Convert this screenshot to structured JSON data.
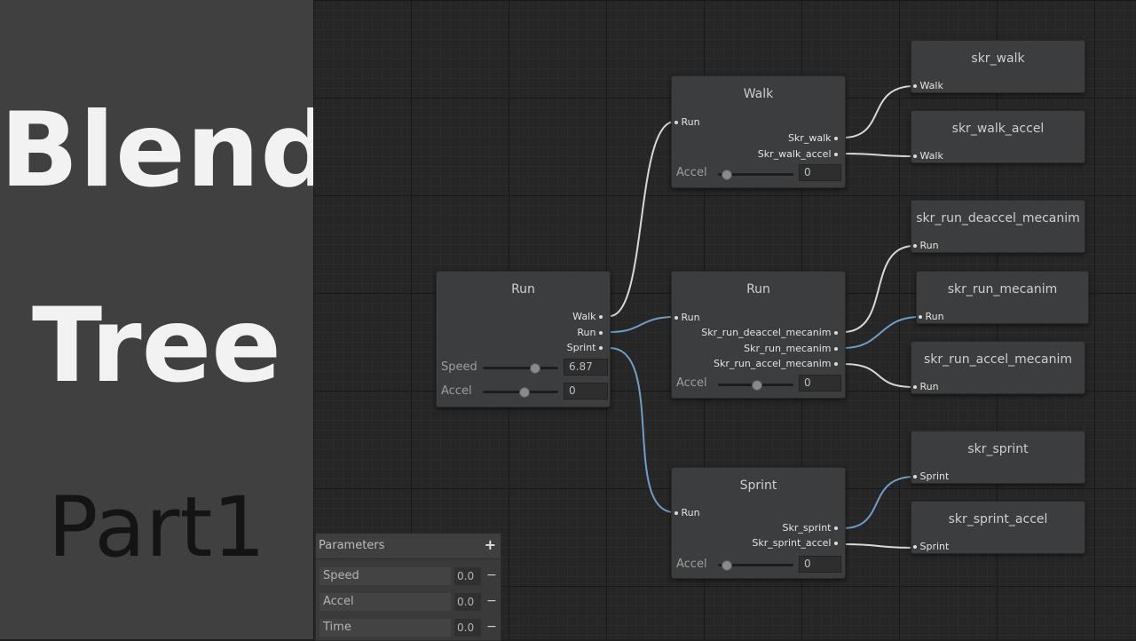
{
  "title_lines": [
    "Blend",
    "Tree",
    "Part1"
  ],
  "nodes": {
    "root": {
      "title": "Run",
      "outputs": [
        "Walk",
        "Run",
        "Sprint"
      ],
      "speed_label": "Speed",
      "speed_value": "6.87",
      "accel_label": "Accel",
      "accel_value": "0"
    },
    "walk": {
      "title": "Walk",
      "input": "Run",
      "outputs": [
        "Skr_walk",
        "Skr_walk_accel"
      ],
      "accel_label": "Accel",
      "accel_value": "0"
    },
    "run": {
      "title": "Run",
      "input": "Run",
      "outputs": [
        "Skr_run_deaccel_mecanim",
        "Skr_run_mecanim",
        "Skr_run_accel_mecanim"
      ],
      "accel_label": "Accel",
      "accel_value": "0"
    },
    "sprint": {
      "title": "Sprint",
      "input": "Run",
      "outputs": [
        "Skr_sprint",
        "Skr_sprint_accel"
      ],
      "accel_label": "Accel",
      "accel_value": "0"
    }
  },
  "clips": [
    {
      "title": "skr_walk",
      "input": "Walk"
    },
    {
      "title": "skr_walk_accel",
      "input": "Walk"
    },
    {
      "title": "skr_run_deaccel_mecanim",
      "input": "Run"
    },
    {
      "title": "skr_run_mecanim",
      "input": "Run"
    },
    {
      "title": "skr_run_accel_mecanim",
      "input": "Run"
    },
    {
      "title": "skr_sprint",
      "input": "Sprint"
    },
    {
      "title": "skr_sprint_accel",
      "input": "Sprint"
    }
  ],
  "parameters": {
    "header": "Parameters",
    "add": "+",
    "remove": "−",
    "items": [
      {
        "name": "Speed",
        "value": "0.0"
      },
      {
        "name": "Accel",
        "value": "0.0"
      },
      {
        "name": "Time",
        "value": "0.0"
      }
    ]
  },
  "sliders": {
    "root_speed": 0.7,
    "root_accel": 0.55,
    "walk_accel": 0.05,
    "run_accel": 0.5,
    "sprint_accel": 0.05
  },
  "colors": {
    "wire": "#d8d8d8",
    "wire_active": "#6f9fc9"
  }
}
